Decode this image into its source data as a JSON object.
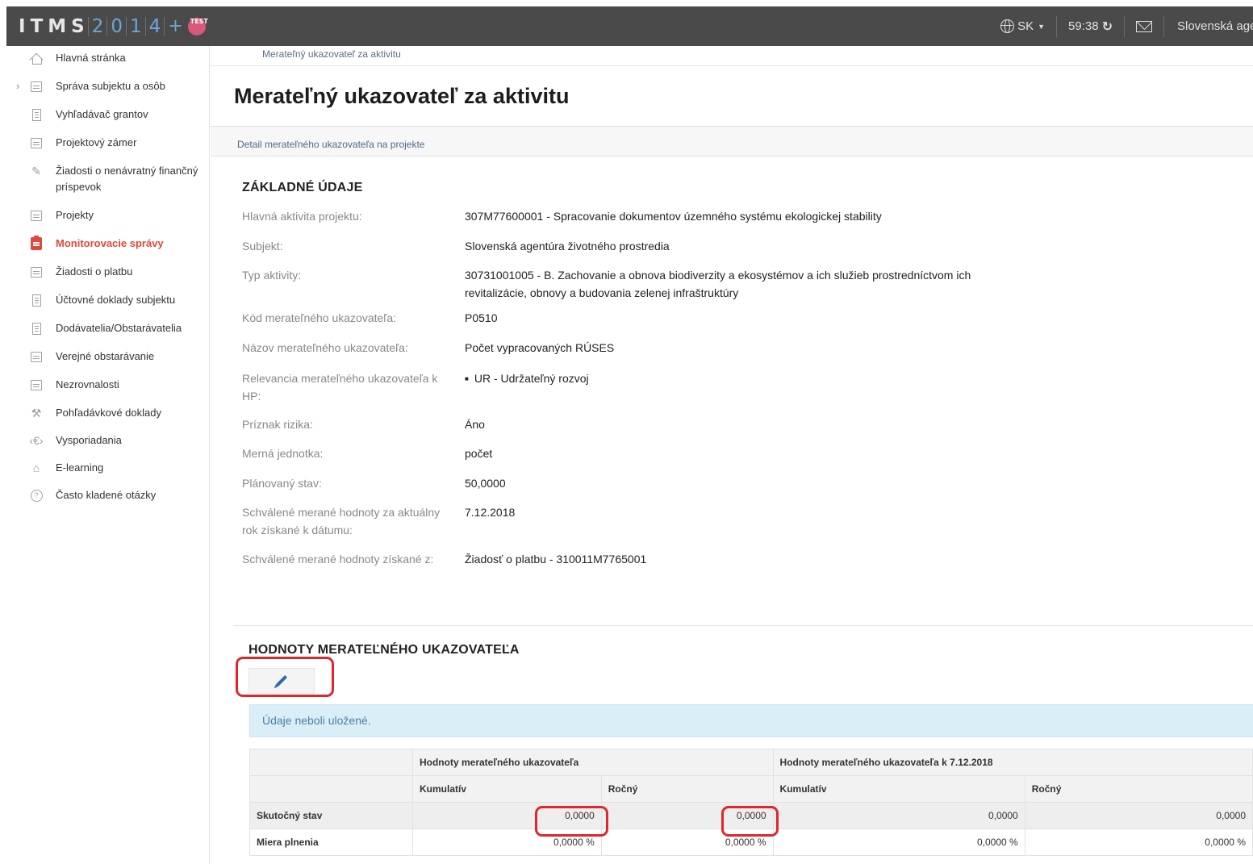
{
  "header": {
    "logo_letters": [
      "I",
      "T",
      "M",
      "S"
    ],
    "logo_digits": [
      "2",
      "0",
      "1",
      "4"
    ],
    "logo_plus": "+",
    "test_badge": "TEST",
    "language": "SK",
    "timer": "59:38",
    "organization": "Slovenská agentúra životného prostredia"
  },
  "sidebar": {
    "items": [
      {
        "label": "Hlavná stránka",
        "icon": "home-icon"
      },
      {
        "label": "Správa subjektu a osôb",
        "icon": "id-card-icon"
      },
      {
        "label": "Vyhľadávač grantov",
        "icon": "document-icon"
      },
      {
        "label": "Projektový zámer",
        "icon": "folder-icon"
      },
      {
        "label": "Žiadosti o nenávratný finančný príspevok",
        "icon": "edit-icon"
      },
      {
        "label": "Projekty",
        "icon": "folder-icon"
      },
      {
        "label": "Monitorovacie správy",
        "icon": "clipboard-icon"
      },
      {
        "label": "Žiadosti o platbu",
        "icon": "payment-icon"
      },
      {
        "label": "Účtovné doklady subjektu",
        "icon": "ledger-icon"
      },
      {
        "label": "Dodávatelia/Obstarávatelia",
        "icon": "truck-icon"
      },
      {
        "label": "Verejné obstarávanie",
        "icon": "tender-icon"
      },
      {
        "label": "Nezrovnalosti",
        "icon": "irregularity-icon"
      },
      {
        "label": "Pohľadávkové doklady",
        "icon": "hammer-icon"
      },
      {
        "label": "Vysporiadania",
        "icon": "settlement-icon"
      },
      {
        "label": "E-learning",
        "icon": "graduation-cap-icon"
      },
      {
        "label": "Často kladené otázky",
        "icon": "question-icon"
      }
    ]
  },
  "breadcrumb": "Merateľný ukazovateľ za aktivitu",
  "page_title": "Merateľný ukazovateľ za aktivitu",
  "subtab": "Detail merateľného ukazovateľa na projekte",
  "basic": {
    "section_title": "ZÁKLADNÉ ÚDAJE",
    "rows": [
      {
        "label": "Hlavná aktivita projektu:",
        "value": "307M77600001 - Spracovanie dokumentov územného systému ekologickej stability"
      },
      {
        "label": "Subjekt:",
        "value": "Slovenská agentúra životného prostredia"
      },
      {
        "label": "Typ aktivity:",
        "value": "30731001005 - B. Zachovanie a obnova biodiverzity a ekosystémov a ich služieb prostredníctvom ich revitalizácie, obnovy a budovania zelenej infraštruktúry"
      },
      {
        "label": "Kód merateľného ukazovateľa:",
        "value": "P0510"
      },
      {
        "label": "Názov merateľného ukazovateľa:",
        "value": "Počet vypracovaných RÚSES"
      },
      {
        "label": "Relevancia merateľného ukazovateľa k HP:",
        "value": "UR - Udržateľný rozvoj"
      },
      {
        "label": "Príznak rizika:",
        "value": "Áno"
      },
      {
        "label": "Merná jednotka:",
        "value": "počet"
      },
      {
        "label": "Plánovaný stav:",
        "value": "50,0000"
      },
      {
        "label": "Schválené merané hodnoty za aktuálny rok získané k dátumu:",
        "value": "7.12.2018"
      },
      {
        "label": "Schválené merané hodnoty získané z:",
        "value": "Žiadosť o platbu - 310011M7765001"
      }
    ]
  },
  "values": {
    "section_title": "HODNOTY MERATEĽNÉHO UKAZOVATEĽA",
    "alert": "Údaje neboli uložené.",
    "table": {
      "group1": "Hodnoty merateľného ukazovateľa",
      "group2": "Hodnoty merateľného ukazovateľa k 7.12.2018",
      "sub_cols": [
        "Kumulatív",
        "Ročný",
        "Kumulatív",
        "Ročný"
      ],
      "rows": [
        {
          "label": "Skutočný stav",
          "cells": [
            "0,0000",
            "0,0000",
            "0,0000",
            "0,0000"
          ]
        },
        {
          "label": "Miera plnenia",
          "cells": [
            "0,0000 %",
            "0,0000 %",
            "0,0000 %",
            "0,0000 %"
          ]
        }
      ]
    }
  },
  "colors": {
    "topbar": "#4a4a4a",
    "accent_active": "#e0483a",
    "highlight_box": "#e0262b",
    "alert_bg": "#d9eef7"
  }
}
